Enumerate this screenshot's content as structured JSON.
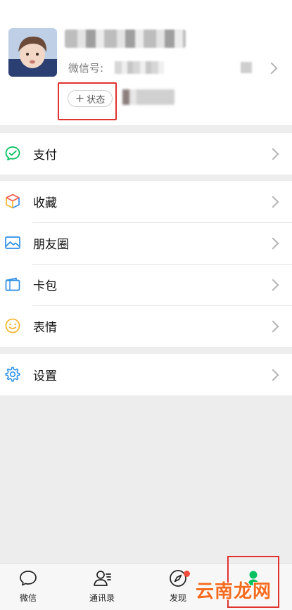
{
  "profile": {
    "wechat_id_label": "微信号:",
    "status_button_plus": "+",
    "status_button_label": "状态"
  },
  "menu": {
    "pay": "支付",
    "favorites": "收藏",
    "moments": "朋友圈",
    "cards": "卡包",
    "stickers": "表情",
    "settings": "设置"
  },
  "tabs": {
    "chats": "微信",
    "contacts": "通讯录",
    "discover": "发现"
  },
  "watermark": "云南龙网",
  "colors": {
    "accent_green": "#07c160",
    "highlight_red": "#e0322e",
    "badge_red": "#f24b3c",
    "watermark_orange": "#f56b1f"
  }
}
